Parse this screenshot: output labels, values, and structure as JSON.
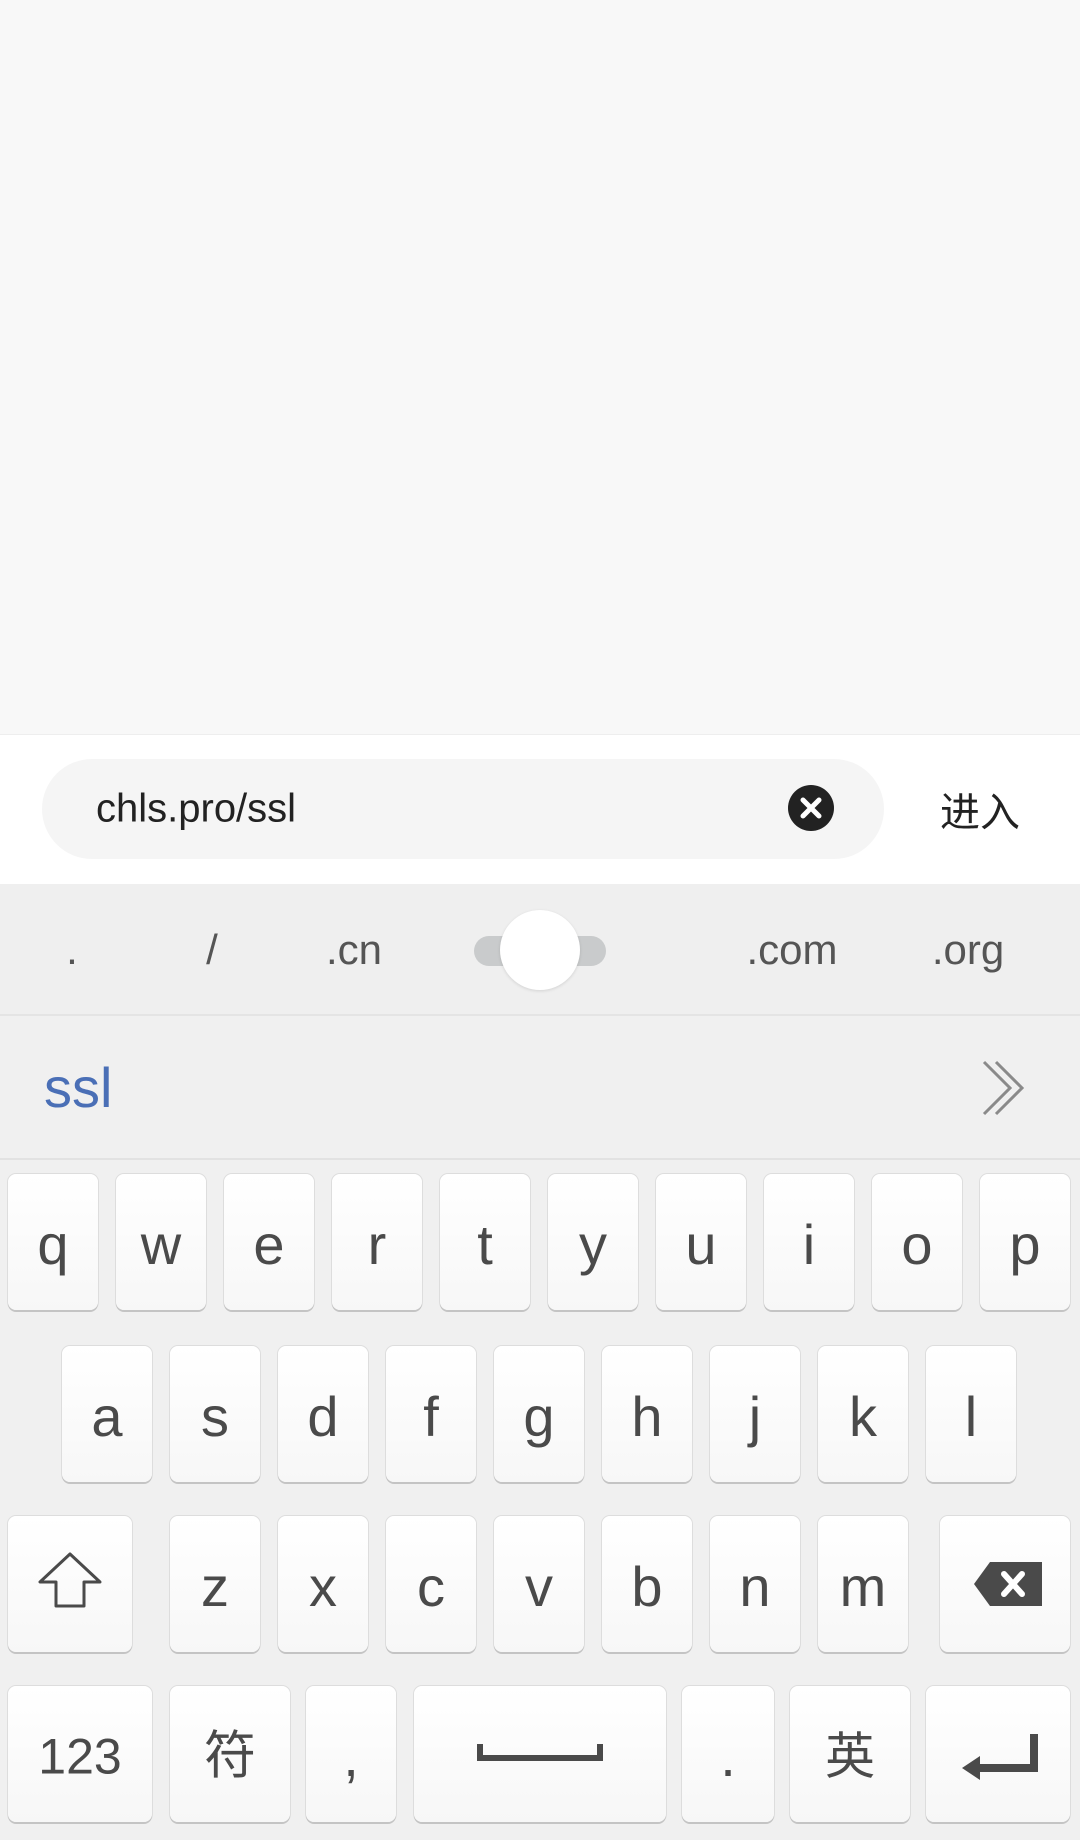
{
  "address_bar": {
    "url_value": "chls.pro/ssl",
    "go_label": "进入",
    "clear_icon": "clear-circle-icon"
  },
  "domain_shortcuts": [
    ".",
    "/",
    ".cn",
    ".com",
    ".org"
  ],
  "candidate": {
    "word": "ssl",
    "expand_icon": "double-chevron-right-icon"
  },
  "keyboard": {
    "row1": [
      "q",
      "w",
      "e",
      "r",
      "t",
      "y",
      "u",
      "i",
      "o",
      "p"
    ],
    "row2": [
      "a",
      "s",
      "d",
      "f",
      "g",
      "h",
      "j",
      "k",
      "l"
    ],
    "row3": [
      "z",
      "x",
      "c",
      "v",
      "b",
      "n",
      "m"
    ],
    "bottom": {
      "numbers_label": "123",
      "symbols_label": "符",
      "comma_label": ",",
      "period_label": ".",
      "language_label": "英"
    },
    "icons": {
      "shift": "shift-arrow-icon",
      "backspace": "backspace-icon",
      "space": "space-bar-icon",
      "enter": "enter-return-icon"
    },
    "colors": {
      "candidate_text": "#4a6fb6",
      "key_text": "#4a4a4a",
      "key_face": "#ffffff",
      "keyboard_bg": "#f0f0f0"
    }
  }
}
